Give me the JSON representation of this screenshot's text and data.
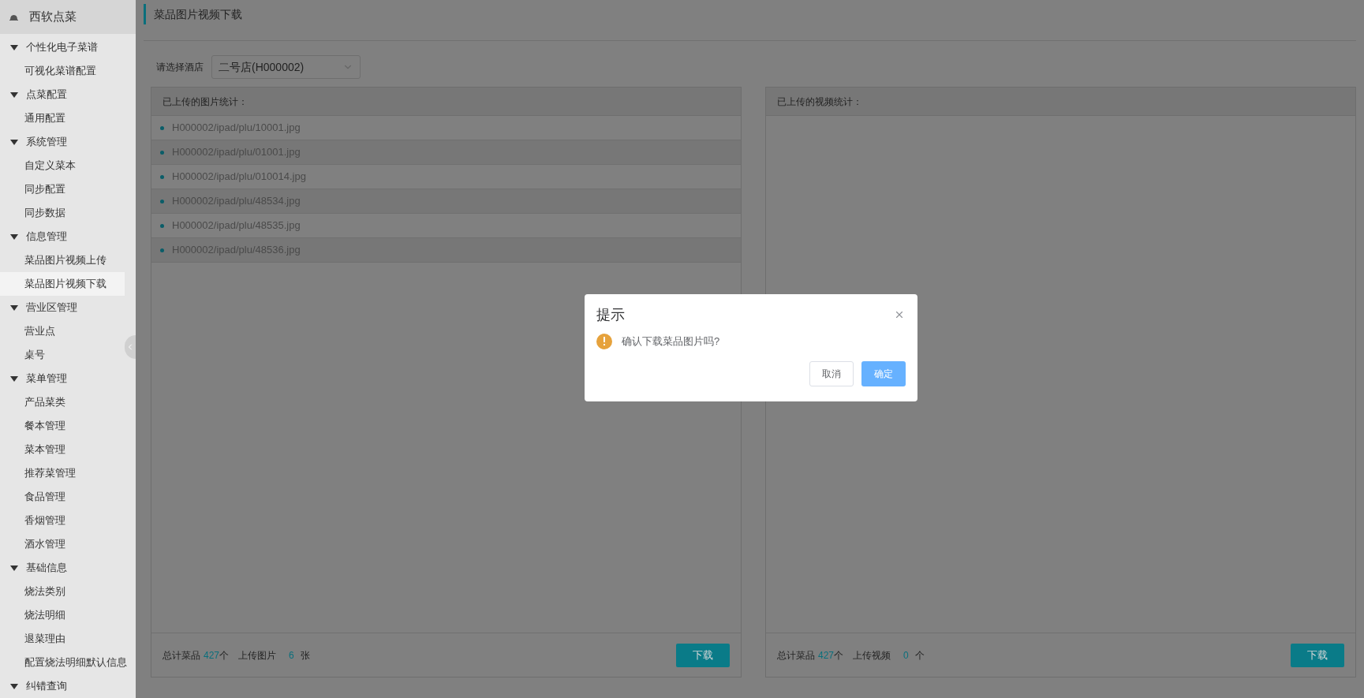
{
  "app_title": "西软点菜",
  "sidebar": {
    "groups": [
      {
        "label": "个性化电子菜谱",
        "expanded": true,
        "children": [
          {
            "label": "可视化菜谱配置",
            "selected": false
          }
        ]
      },
      {
        "label": "点菜配置",
        "expanded": true,
        "children": [
          {
            "label": "通用配置",
            "selected": false
          }
        ]
      },
      {
        "label": "系统管理",
        "expanded": true,
        "children": [
          {
            "label": "自定义菜本",
            "selected": false
          },
          {
            "label": "同步配置",
            "selected": false
          },
          {
            "label": "同步数据",
            "selected": false
          }
        ]
      },
      {
        "label": "信息管理",
        "expanded": true,
        "children": [
          {
            "label": "菜品图片视频上传",
            "selected": false
          },
          {
            "label": "菜品图片视频下载",
            "selected": true
          }
        ]
      },
      {
        "label": "营业区管理",
        "expanded": true,
        "children": [
          {
            "label": "营业点",
            "selected": false
          },
          {
            "label": "桌号",
            "selected": false
          }
        ]
      },
      {
        "label": "菜单管理",
        "expanded": true,
        "children": [
          {
            "label": "产品菜类",
            "selected": false
          },
          {
            "label": "餐本管理",
            "selected": false
          },
          {
            "label": "菜本管理",
            "selected": false
          },
          {
            "label": "推荐菜管理",
            "selected": false
          },
          {
            "label": "食品管理",
            "selected": false
          },
          {
            "label": "香烟管理",
            "selected": false
          },
          {
            "label": "酒水管理",
            "selected": false
          }
        ]
      },
      {
        "label": "基础信息",
        "expanded": true,
        "children": [
          {
            "label": "烧法类别",
            "selected": false
          },
          {
            "label": "烧法明细",
            "selected": false
          },
          {
            "label": "退菜理由",
            "selected": false
          },
          {
            "label": "配置烧法明细默认信息",
            "selected": false
          }
        ]
      },
      {
        "label": "纠错查询",
        "expanded": true
      }
    ]
  },
  "page_title": "菜品图片视频下载",
  "hotel_select": {
    "label": "请选择酒店",
    "value": "二号店(H000002)"
  },
  "panels": [
    {
      "title": "已上传的图片统计：",
      "files": [
        "H000002/ipad/plu/10001.jpg",
        "H000002/ipad/plu/01001.jpg",
        "H000002/ipad/plu/010014.jpg",
        "H000002/ipad/plu/48534.jpg",
        "H000002/ipad/plu/48535.jpg",
        "H000002/ipad/plu/48536.jpg"
      ],
      "footer": {
        "total_label": "总计菜品",
        "total_value": "427",
        "total_unit": "个",
        "upload_label": "上传图片",
        "upload_value": "6",
        "upload_unit": "张"
      },
      "button": "下载"
    },
    {
      "title": "已上传的视频统计：",
      "footer": {
        "total_label": "总计菜品",
        "total_value": "427",
        "total_unit": "个",
        "upload_label": "上传视频",
        "upload_value": "0",
        "upload_unit": "个"
      },
      "button": "下载"
    }
  ],
  "dialog": {
    "title": "提示",
    "message": "确认下载菜品图片吗?",
    "buttons": [
      {
        "label": "取消",
        "kind": "secondary"
      },
      {
        "label": "确定",
        "kind": "primary"
      }
    ]
  }
}
